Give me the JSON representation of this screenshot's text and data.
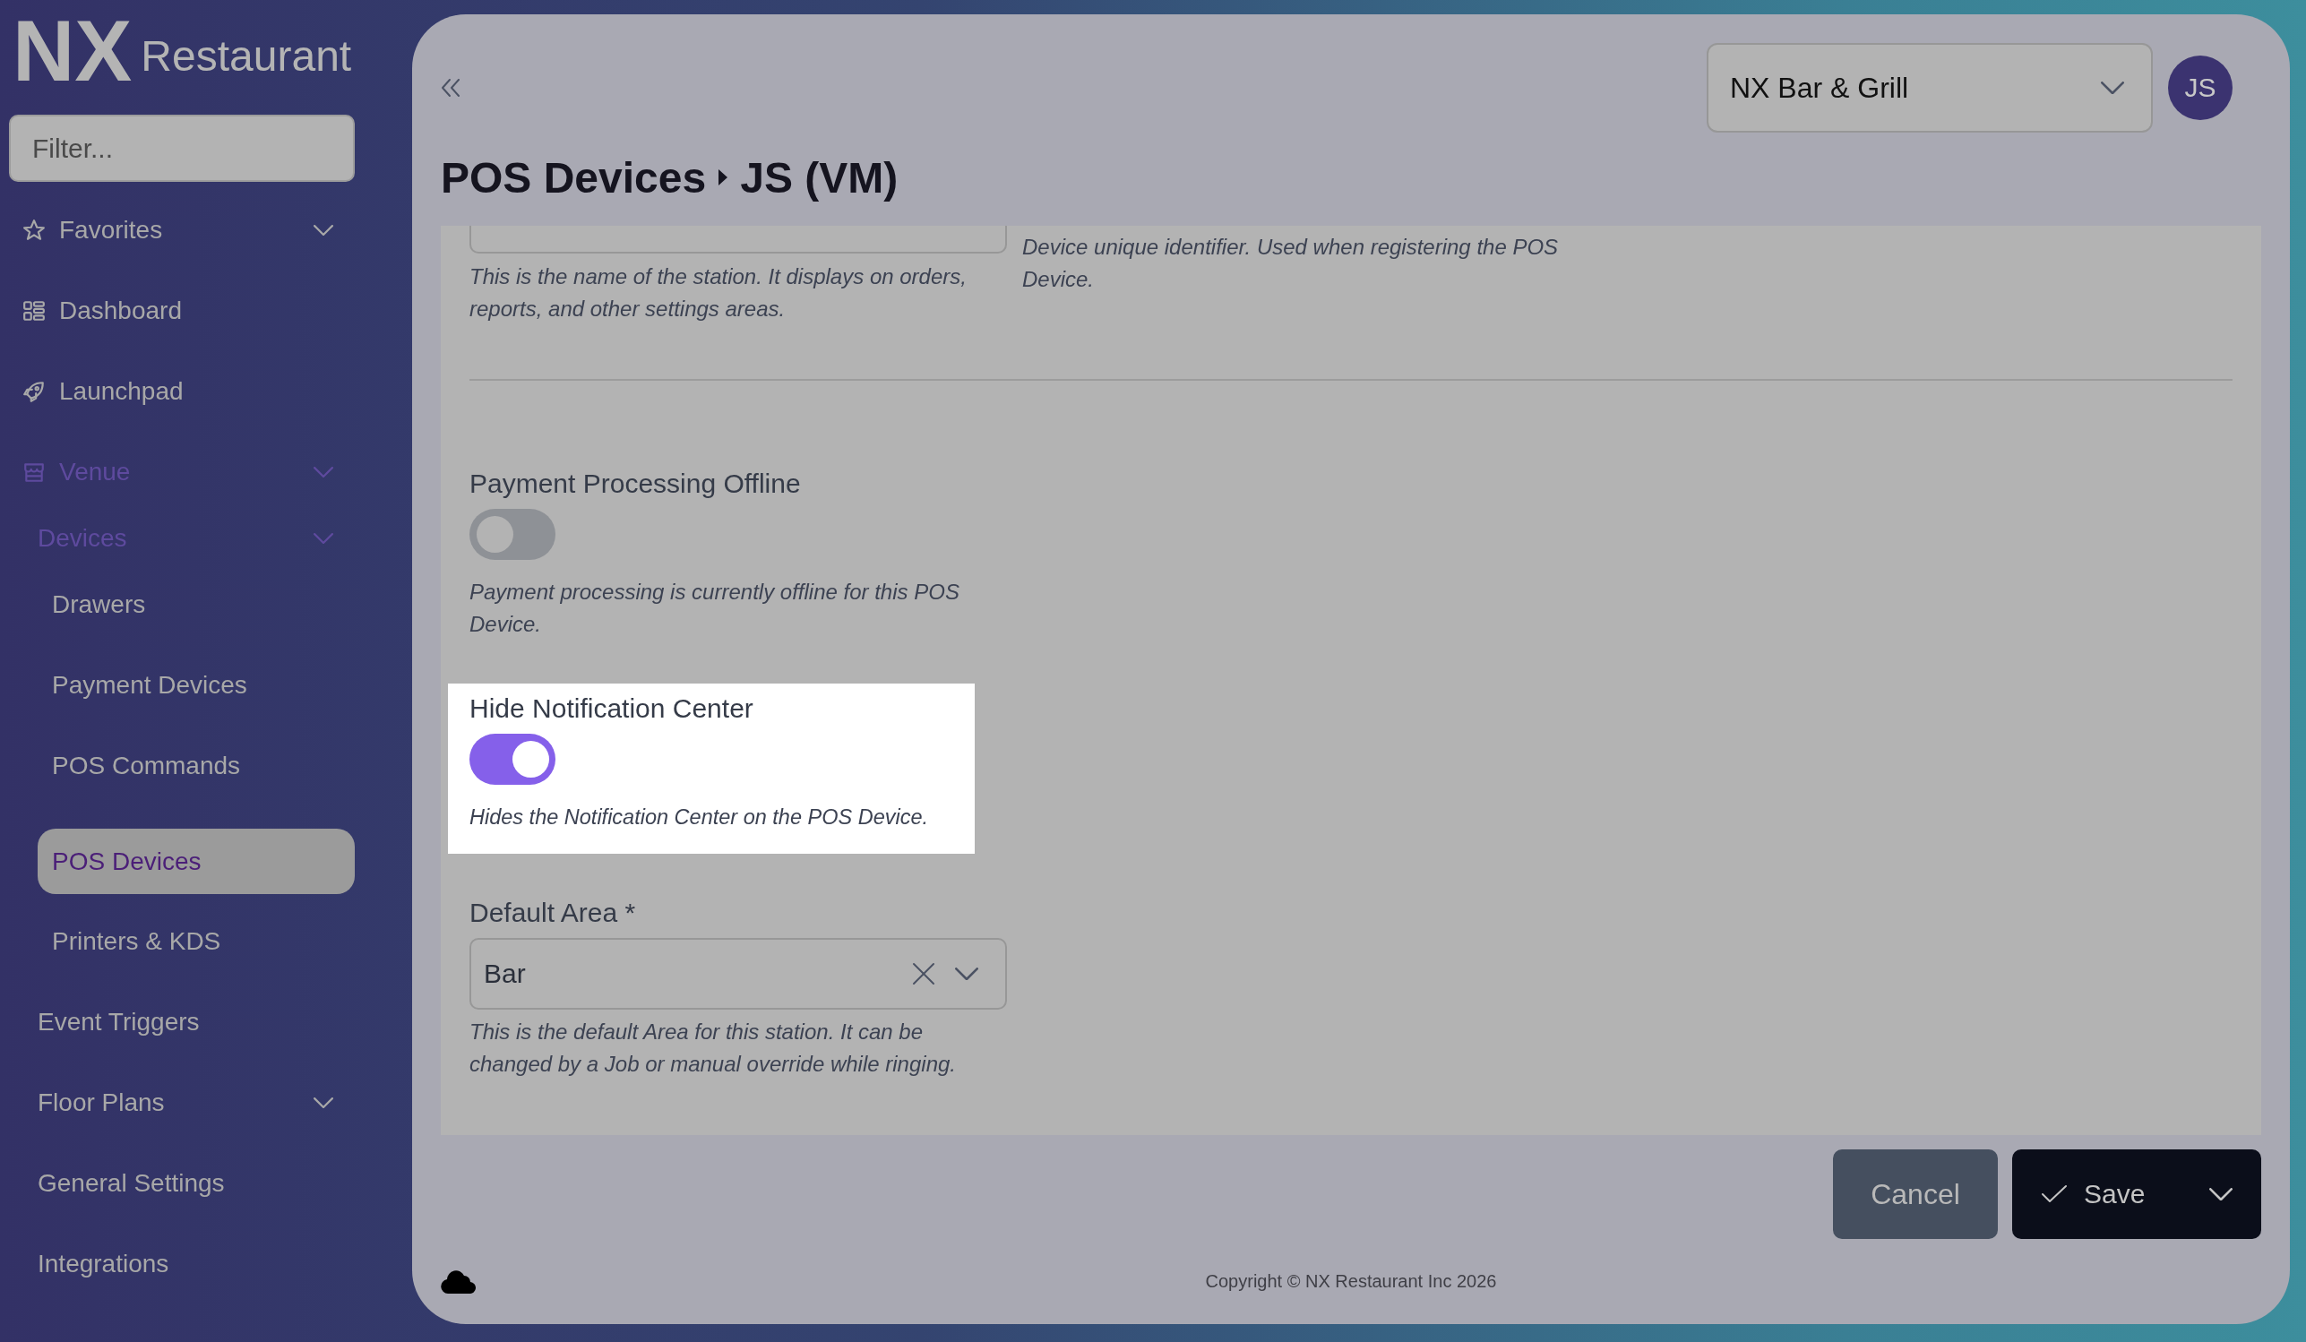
{
  "sidebar": {
    "logo": {
      "mark": "NX",
      "name": "Restaurant"
    },
    "filter": {
      "placeholder": "Filter..."
    },
    "items": [
      {
        "label": "Favorites",
        "expandable": true,
        "active": false,
        "selected": false
      },
      {
        "label": "Dashboard",
        "expandable": false,
        "active": false,
        "selected": false
      },
      {
        "label": "Launchpad",
        "expandable": false,
        "active": false,
        "selected": false
      },
      {
        "label": "Venue",
        "expandable": true,
        "active": true,
        "selected": false,
        "children": [
          {
            "label": "Devices",
            "expandable": true,
            "active": true,
            "selected": false,
            "children": [
              {
                "label": "Drawers",
                "expandable": false,
                "active": false,
                "selected": false
              },
              {
                "label": "Payment Devices",
                "expandable": false,
                "active": false,
                "selected": false
              },
              {
                "label": "POS Commands",
                "expandable": false,
                "active": false,
                "selected": false
              },
              {
                "label": "POS Devices",
                "expandable": false,
                "active": false,
                "selected": true
              },
              {
                "label": "Printers & KDS",
                "expandable": false,
                "active": false,
                "selected": false
              }
            ]
          },
          {
            "label": "Event Triggers",
            "expandable": false,
            "active": false,
            "selected": false
          },
          {
            "label": "Floor Plans",
            "expandable": true,
            "active": false,
            "selected": false
          },
          {
            "label": "General Settings",
            "expandable": false,
            "active": false,
            "selected": false
          },
          {
            "label": "Integrations",
            "expandable": false,
            "active": false,
            "selected": false
          }
        ]
      }
    ]
  },
  "header": {
    "venue": "NX Bar & Grill",
    "avatar": "JS",
    "breadcrumb": [
      "POS Devices",
      "JS (VM)"
    ]
  },
  "form": {
    "top_fields": [
      {
        "kind": "input",
        "help": "This is the name of the station. It displays on orders, reports, and other settings areas."
      },
      {
        "kind": "note",
        "help": "Device unique identifier. Used when registering the POS Device."
      }
    ],
    "fields": [
      {
        "kind": "toggle",
        "label": "Payment Processing Offline",
        "on": false,
        "highlighted": false,
        "help": "Payment processing is currently offline for this POS Device."
      },
      {
        "kind": "toggle",
        "label": "Hide Notification Center",
        "on": true,
        "highlighted": true,
        "help": "Hides the Notification Center on the POS Device."
      },
      {
        "kind": "select",
        "label": "Default Area *",
        "value": "Bar",
        "highlighted": false,
        "help": "This is the default Area for this station. It can be changed by a Job or manual override while ringing."
      }
    ]
  },
  "actions": {
    "cancel": "Cancel",
    "save": "Save"
  },
  "footer": {
    "copyright": "Copyright © NX Restaurant Inc 2026"
  }
}
